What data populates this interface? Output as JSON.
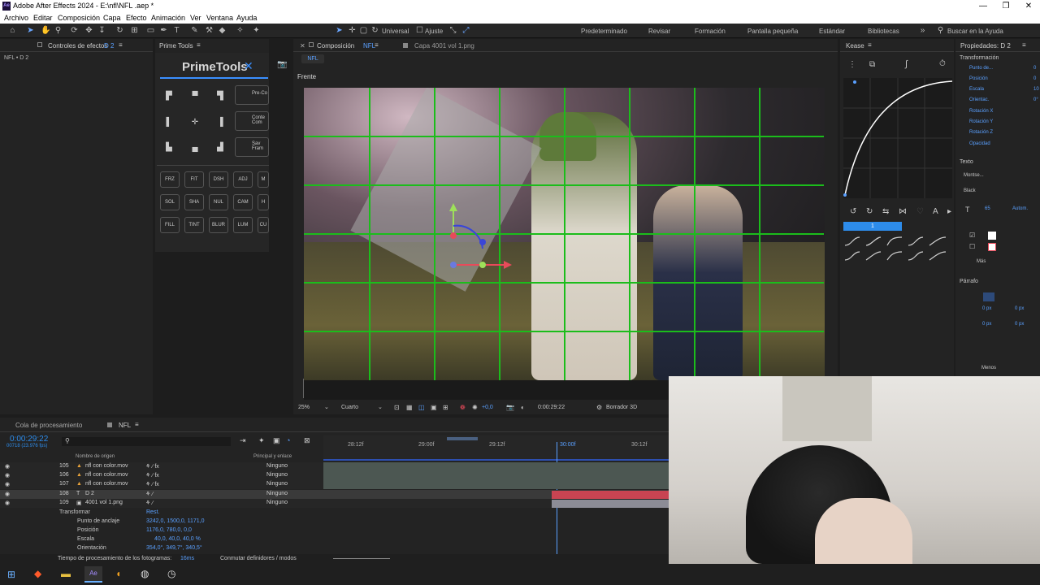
{
  "window": {
    "title": "Adobe After Effects 2024 - E:\\nfl\\NFL .aep *",
    "icon": "ae-icon"
  },
  "menu": [
    "Archivo",
    "Editar",
    "Composición",
    "Capa",
    "Efecto",
    "Animación",
    "Ver",
    "Ventana",
    "Ayuda"
  ],
  "toolbar": {
    "universal": "Universal",
    "ajuste": "Ajuste",
    "search_placeholder": "Buscar en la Ayuda"
  },
  "workspaces": [
    "Predeterminado",
    "Revisar",
    "Formación",
    "Pantalla pequeña",
    "Estándar",
    "Bibliotecas"
  ],
  "effects_panel": {
    "tab": "Controles de efectos",
    "layer": "D 2",
    "breadcrumb": "NFL • D 2"
  },
  "primetools": {
    "tab": "Prime Tools",
    "title": "PrimeTools",
    "side_buttons": [
      "Pre-Co",
      "Conte Com",
      "Sav Fram"
    ],
    "buttons_row1": [
      "FRZ",
      "FIT",
      "DSH",
      "ADJ",
      "M"
    ],
    "buttons_row2": [
      "SOL",
      "SHA",
      "NUL",
      "CAM",
      "H"
    ],
    "buttons_row3": [
      "FILL",
      "TINT",
      "BLUR",
      "LUM",
      "CU"
    ]
  },
  "composition": {
    "tab": "Composición",
    "name": "NFL",
    "footage_tab": "Capa 4001 vol 1.png",
    "subtab": "NFL",
    "view_label": "Frente",
    "zoom": "25%",
    "resolution": "Cuarto",
    "exposure": "+0,0",
    "timecode": "0:00:29:22",
    "renderer": "Borrador 3D"
  },
  "kease": {
    "tab": "Kease",
    "slider_value": "1"
  },
  "properties": {
    "tab": "Propiedades: D 2",
    "section": "Transformación",
    "items": [
      "Punto de...",
      "Posición",
      "Escala",
      "Orientac.",
      "Rotación X",
      "Rotación Y",
      "Rotación Z",
      "Opacidad"
    ],
    "values": [
      "0",
      "0",
      "10",
      "0°"
    ],
    "text_section": "Texto",
    "font": "Montse...",
    "style": "Black",
    "font_size": "65",
    "auto": "Autom.",
    "more": "Más",
    "paragraph": "Párrafo",
    "px1": "0 px",
    "px2": "0 px",
    "px3": "0 px",
    "px4": "0 px",
    "less": "Menos"
  },
  "timeline": {
    "tabs": [
      "Cola de procesamiento",
      "NFL"
    ],
    "timecode": "0:00:29:22",
    "fps": "00718 (23.976 fps)",
    "col_source": "Nombre de origen",
    "col_parent": "Principal y enlace",
    "ruler": [
      "28:12f",
      "29:00f",
      "29:12f",
      "30:00f",
      "30:12f"
    ],
    "layers": [
      {
        "num": "105",
        "name": "nfl con color.mov",
        "parent": "Ninguno",
        "color": "#b8b8b8"
      },
      {
        "num": "106",
        "name": "nfl con color.mov",
        "parent": "Ninguno",
        "color": "#b8b8b8"
      },
      {
        "num": "107",
        "name": "nfl con color.mov",
        "parent": "Ninguno",
        "color": "#b8b8b8"
      },
      {
        "num": "108",
        "name": "D 2",
        "parent": "Ninguno",
        "color": "#d34a5a"
      },
      {
        "num": "109",
        "name": "4001 vol 1.png",
        "parent": "Ninguno",
        "color": "#b8b8b8"
      }
    ],
    "transform_label": "Transformar",
    "reset": "Rest.",
    "props": [
      {
        "name": "Punto de anclaje",
        "value": "3242,0, 1500,0, 1171,0"
      },
      {
        "name": "Posición",
        "value": "1176,0, 780,0, 0,0"
      },
      {
        "name": "Escala",
        "value": "40,0, 40,0, 40,0 %"
      },
      {
        "name": "Orientación",
        "value": "354,0°, 349,7°, 340,5°"
      }
    ],
    "footer_left": "Tiempo de procesamiento de los fotogramas:",
    "footer_time": "16ms",
    "footer_toggle": "Conmutar definidores / modos"
  },
  "taskbar": [
    "windows-icon",
    "brave-icon",
    "explorer-icon",
    "after-effects-icon",
    "app-icon",
    "chrome-icon",
    "clock-app-icon"
  ],
  "colors": {
    "accent": "#2d8ceb",
    "timecode": "#2d8ceb",
    "label_red": "#d34a5a",
    "grid": "#1bbd1b"
  }
}
